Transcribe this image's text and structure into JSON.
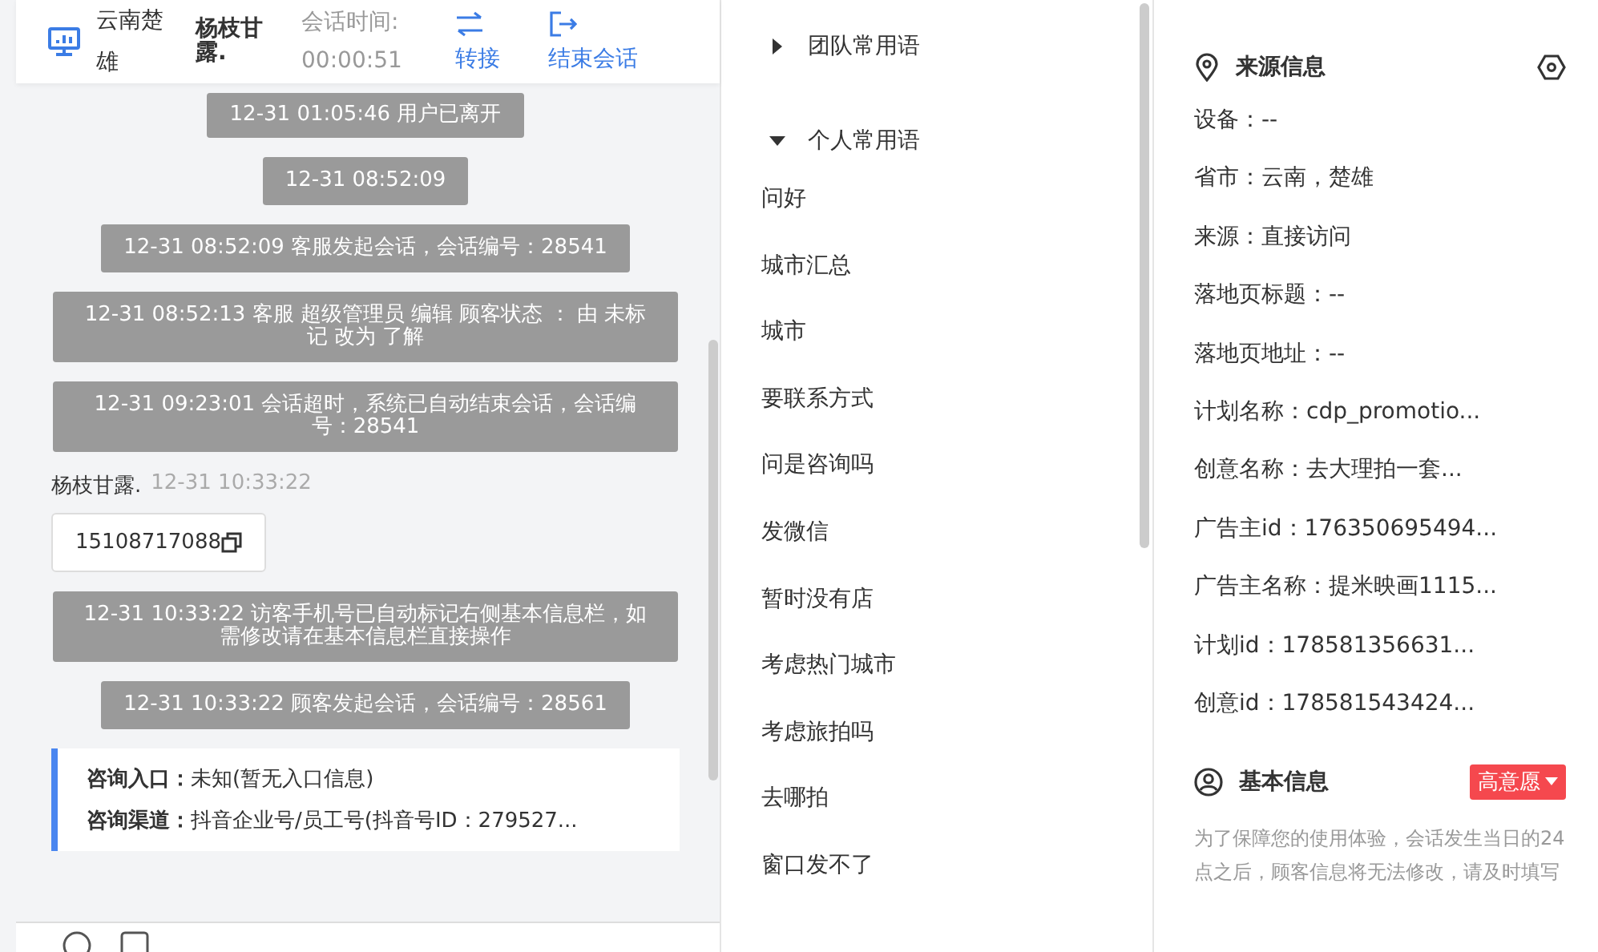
{
  "header": {
    "location": "云南楚雄",
    "name": "杨枝甘露.",
    "time_label": "会话时间:",
    "time": "00:00:51",
    "actions": [
      {
        "kind": "transfer",
        "label": "转接"
      },
      {
        "kind": "end",
        "label": "结束会话"
      }
    ]
  },
  "messages": [
    {
      "kind": "system",
      "text": "12-31 01:05:46 用户已离开"
    },
    {
      "kind": "system",
      "text": "12-31 08:52:09"
    },
    {
      "kind": "system",
      "text": "12-31 08:52:09 客服发起会话，会话编号：28541"
    },
    {
      "kind": "system",
      "text": "12-31 08:52:13 客服 超级管理员 编辑 顾客状态 ： 由 未标记 改为 了解"
    },
    {
      "kind": "system",
      "text": "12-31 09:23:01 会话超时，系统已自动结束会话，会话编号：28541"
    },
    {
      "kind": "user",
      "sender": "杨枝甘露.",
      "time": "12-31 10:33:22",
      "text": "15108717088"
    },
    {
      "kind": "system",
      "text": "12-31 10:33:22 访客手机号已自动标记右侧基本信息栏，如需修改请在基本信息栏直接操作"
    },
    {
      "kind": "system",
      "text": "12-31 10:33:22 顾客发起会话，会话编号：28561"
    },
    {
      "kind": "card",
      "rows": [
        {
          "label": "咨询入口：",
          "value": "未知(暂无入口信息)"
        },
        {
          "label": "咨询渠道：",
          "value": "抖音企业号/员工号(抖音号ID：279527..."
        }
      ]
    }
  ],
  "phrases": [
    {
      "title": "团队常用语",
      "expanded": false
    },
    {
      "title": "个人常用语",
      "expanded": true,
      "items": [
        "问好",
        "城市汇总",
        "城市",
        "要联系方式",
        "问是咨询吗",
        "发微信",
        "暂时没有店",
        "考虑热门城市",
        "考虑旅拍吗",
        "去哪拍",
        "窗口发不了"
      ]
    }
  ],
  "source": {
    "title": "来源信息",
    "fields": [
      "设备：--",
      "省市：云南，楚雄",
      "来源：直接访问",
      "落地页标题：--",
      "落地页地址：--",
      "计划名称：cdp_promotio...",
      "创意名称：去大理拍一套...",
      "广告主id：176350695494...",
      "广告主名称：提米映画1115...",
      "计划id：178581356631...",
      "创意id：178581543424..."
    ]
  },
  "basic": {
    "title": "基本信息",
    "tag": "高意愿",
    "notice": "为了保障您的使用体验，会话发生当日的24点之后，顾客信息将无法修改，请及时填写"
  }
}
